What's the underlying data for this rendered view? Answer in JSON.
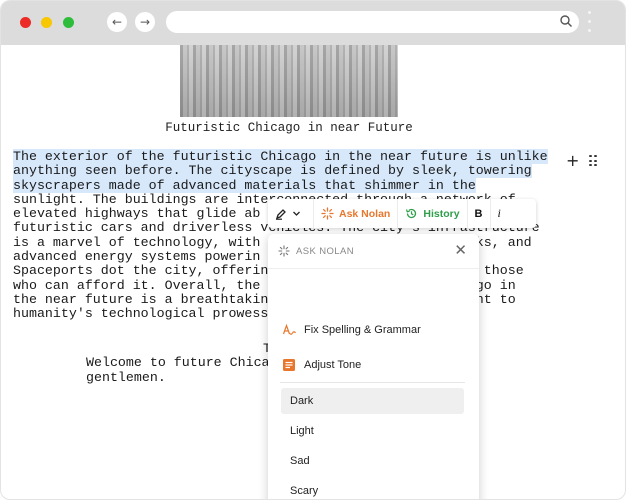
{
  "document": {
    "caption": "Futuristic Chicago in near Future",
    "paragraph_highlighted": [
      "The exterior of the futuristic Chicago in the near future is unlike",
      "anything seen before. The cityscape is defined by sleek, towering",
      "skyscrapers made of advanced materials that shimmer in the"
    ],
    "paragraph_rest": [
      "sunlight. The buildings are interconnected through a network of",
      "elevated highways that glide ab                          with",
      "futuristic cars and driverless vehicles. The city's infrastructure",
      "is a marvel of technology, with                        works, and",
      "advanced energy systems powerin                        fe.",
      "Spaceports dot the city, offerin                       for those",
      "who can afford it. Overall, the                        icago in",
      "the near future is a breathtakin                       ament to",
      "humanity's technological prowess"
    ],
    "poem_title": "T",
    "poem_lines": [
      "Welcome to future Chica",
      "gentlemen."
    ]
  },
  "toolbar": {
    "ask_nolan_label": "Ask Nolan",
    "history_label": "History",
    "bold_label": "B",
    "italic_label": "i"
  },
  "menu": {
    "title": "ASK NOLAN",
    "close_label": "✕",
    "actions": [
      {
        "label": "Fix Spelling & Grammar",
        "icon": "spellcheck-icon"
      },
      {
        "label": "Adjust Tone",
        "icon": "document-icon"
      }
    ],
    "tone_options": [
      "Dark",
      "Light",
      "Sad",
      "Scary"
    ],
    "selected_option": "Dark"
  },
  "colors": {
    "accent_orange": "#e8772e",
    "history_green": "#2f9e4a",
    "highlight": "#d7e8fb"
  }
}
